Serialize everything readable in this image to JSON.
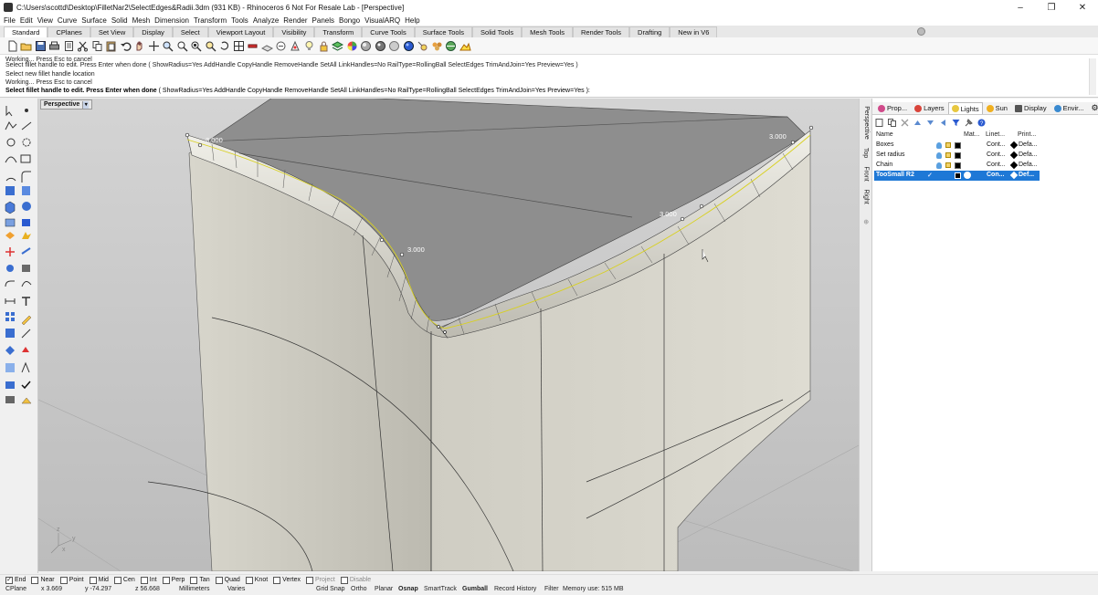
{
  "window": {
    "title": "C:\\Users\\scottd\\Desktop\\FilletNar2\\SelectEdges&Radii.3dm (931 KB) - Rhinoceros 6 Not For Resale Lab - [Perspective]",
    "controls": [
      "–",
      "❐",
      "✕"
    ]
  },
  "menu": {
    "items": [
      "File",
      "Edit",
      "View",
      "Curve",
      "Surface",
      "Solid",
      "Mesh",
      "Dimension",
      "Transform",
      "Tools",
      "Analyze",
      "Render",
      "Panels",
      "Bongo",
      "VisualARQ",
      "Help"
    ]
  },
  "toolbar_tabs": {
    "items": [
      "Standard",
      "CPlanes",
      "Set View",
      "Display",
      "Select",
      "Viewport Layout",
      "Visibility",
      "Transform",
      "Curve Tools",
      "Surface Tools",
      "Solid Tools",
      "Mesh Tools",
      "Render Tools",
      "Drafting",
      "New in V6"
    ],
    "active": "Standard"
  },
  "command_history": {
    "lines": [
      "Working... Press Esc to cancel",
      "Select fillet handle to edit. Press Enter when done ( ShowRadius=Yes  AddHandle  CopyHandle  RemoveHandle  SetAll  LinkHandles=No  RailType=RollingBall  SelectEdges  TrimAndJoin=Yes  Preview=Yes )",
      "Select new fillet handle location",
      "Working... Press Esc to cancel"
    ],
    "prompt": "Select fillet handle to edit. Press Enter when done",
    "prompt_options": "( ShowRadius=Yes  AddHandle  CopyHandle  RemoveHandle  SetAll  LinkHandles=No  RailType=RollingBall  SelectEdges  TrimAndJoin=Yes  Preview=Yes ):"
  },
  "viewport": {
    "name": "Perspective",
    "radius_labels": [
      "3.000",
      "3.000",
      "3.000",
      "3.000"
    ],
    "axis_labels": [
      "z",
      "y",
      "x"
    ]
  },
  "view_tabs": [
    "Perspective",
    "Top",
    "Front",
    "Right"
  ],
  "panel": {
    "tabs": [
      {
        "label": "Prop...",
        "color": "#d04a8a"
      },
      {
        "label": "Layers",
        "color": "#d9443a"
      },
      {
        "label": "Lights",
        "color": "#e8c840"
      },
      {
        "label": "Sun",
        "color": "#f0b020"
      },
      {
        "label": "Display",
        "color": "#555555"
      },
      {
        "label": "Envir...",
        "color": "#3a8ad0"
      }
    ],
    "active_tab": "Layers",
    "columns": [
      "Name",
      "Mat...",
      "Linet...",
      "Print..."
    ],
    "layers": [
      {
        "name": "Boxes",
        "linetype": "Cont...",
        "print": "Defa...",
        "selected": false
      },
      {
        "name": "Set radius",
        "linetype": "Cont...",
        "print": "Defa...",
        "selected": false
      },
      {
        "name": "Chain",
        "linetype": "Cont...",
        "print": "Defa...",
        "selected": false
      },
      {
        "name": "TooSmall R2",
        "linetype": "Con...",
        "print": "Def...",
        "selected": true
      }
    ]
  },
  "osnap": {
    "items": [
      {
        "label": "End",
        "checked": true
      },
      {
        "label": "Near",
        "checked": false
      },
      {
        "label": "Point",
        "checked": false
      },
      {
        "label": "Mid",
        "checked": false
      },
      {
        "label": "Cen",
        "checked": false
      },
      {
        "label": "Int",
        "checked": false
      },
      {
        "label": "Perp",
        "checked": false
      },
      {
        "label": "Tan",
        "checked": false
      },
      {
        "label": "Quad",
        "checked": false
      },
      {
        "label": "Knot",
        "checked": false
      },
      {
        "label": "Vertex",
        "checked": false
      },
      {
        "label": "Project",
        "checked": false,
        "disabled": true
      },
      {
        "label": "Disable",
        "checked": false,
        "disabled": true
      }
    ]
  },
  "status": {
    "cplane": "CPlane",
    "x": "x 3.669",
    "y": "y -74.297",
    "z": "z 56.668",
    "units": "Millimeters",
    "layer": "Varies",
    "grid_snap": "Grid Snap",
    "ortho": "Ortho",
    "planar": "Planar",
    "osnap": "Osnap",
    "smarttrack": "SmartTrack",
    "gumball": "Gumball",
    "record_history": "Record History",
    "filter": "Filter",
    "memory": "Memory use: 515 MB"
  }
}
